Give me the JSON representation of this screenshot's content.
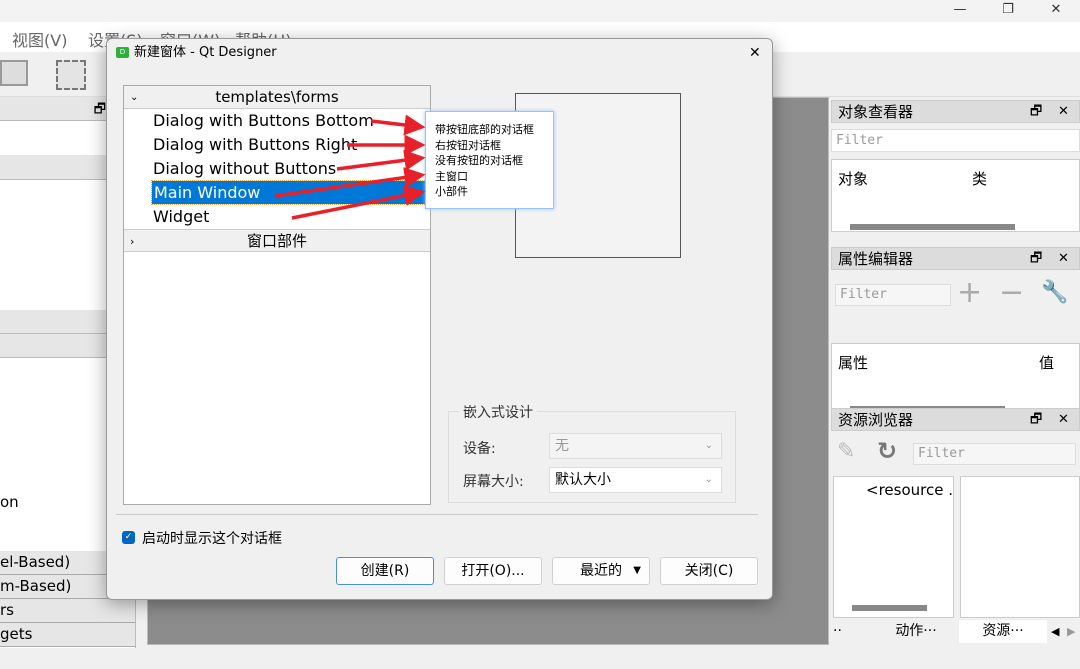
{
  "window": {
    "minimize": "—",
    "maximize": "❐",
    "close": "✕"
  },
  "menubar": [
    "视图(V)",
    "设置(S)",
    "窗口(W)",
    "帮助(H)"
  ],
  "left_panel": {
    "partial_texts": [
      "on"
    ],
    "rows": [
      "el-Based)",
      "m-Based)",
      "rs",
      "gets"
    ]
  },
  "dialog": {
    "title": "新建窗体 - Qt Designer",
    "close": "✕",
    "tree": {
      "group1": "templates\\forms",
      "items": [
        "Dialog with Buttons Bottom",
        "Dialog with Buttons Right",
        "Dialog without Buttons",
        "Main Window",
        "Widget"
      ],
      "selected": "Main Window",
      "group2": "窗口部件"
    },
    "tooltip": [
      "带按钮底部的对话框",
      "右按钮对话框",
      "没有按钮的对话框",
      "主窗口",
      "小部件"
    ],
    "embedded": {
      "title": "嵌入式设计",
      "device_label": "设备:",
      "device_value": "无",
      "screen_label": "屏幕大小:",
      "screen_value": "默认大小"
    },
    "show_on_start": {
      "label": "启动时显示这个对话框",
      "checked": true
    },
    "buttons": {
      "create": "创建(R)",
      "open": "打开(O)...",
      "recent": "最近的",
      "close": "关闭(C)"
    }
  },
  "object_inspector": {
    "title": "对象查看器",
    "filter_placeholder": "Filter",
    "columns": [
      "对象",
      "类"
    ]
  },
  "property_editor": {
    "title": "属性编辑器",
    "filter_placeholder": "Filter",
    "columns": [
      "属性",
      "值"
    ]
  },
  "resource_browser": {
    "title": "资源浏览器",
    "filter_placeholder": "Filter",
    "root": "<resource ."
  },
  "bottom_tabs": [
    "··",
    "动作···",
    "资源···"
  ],
  "colors": {
    "selection": "#0078d7",
    "arrow": "#e8202a"
  }
}
